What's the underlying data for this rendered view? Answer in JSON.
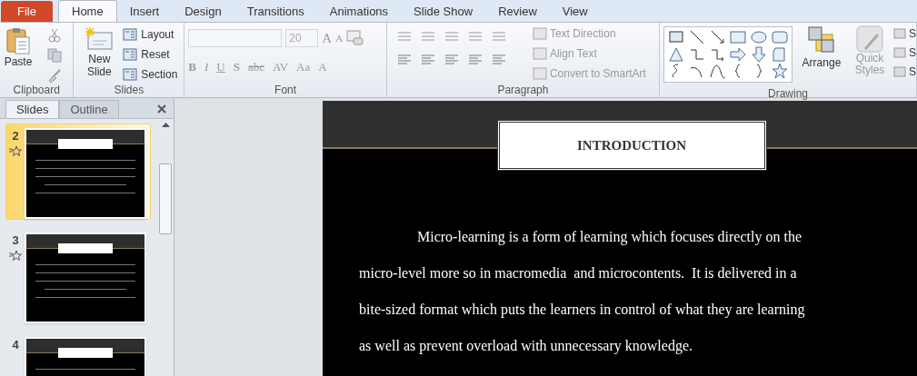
{
  "tabs": [
    {
      "label": "File",
      "kind": "file",
      "selected": false
    },
    {
      "label": "Home",
      "kind": "tab",
      "selected": true
    },
    {
      "label": "Insert",
      "kind": "tab",
      "selected": false
    },
    {
      "label": "Design",
      "kind": "tab",
      "selected": false
    },
    {
      "label": "Transitions",
      "kind": "tab",
      "selected": false
    },
    {
      "label": "Animations",
      "kind": "tab",
      "selected": false
    },
    {
      "label": "Slide Show",
      "kind": "tab",
      "selected": false
    },
    {
      "label": "Review",
      "kind": "tab",
      "selected": false
    },
    {
      "label": "View",
      "kind": "tab",
      "selected": false
    }
  ],
  "ribbon": {
    "clipboard": {
      "label": "Clipboard",
      "paste": "Paste"
    },
    "slides": {
      "label": "Slides",
      "new_slide": [
        "New",
        "Slide"
      ],
      "commands": [
        "Layout",
        "Reset",
        "Section"
      ]
    },
    "font": {
      "label": "Font",
      "font_size": "20",
      "size_buttons": [
        "A",
        "A"
      ],
      "disabled": true,
      "format_buttons": [
        "B",
        "I",
        "U",
        "S",
        "abc",
        "AV",
        "Aa",
        "A"
      ]
    },
    "paragraph": {
      "label": "Paragraph",
      "commands": [
        {
          "label": "Text Direction",
          "disabled": true
        },
        {
          "label": "Align Text",
          "disabled": true
        },
        {
          "label": "Convert to SmartArt",
          "disabled": true
        }
      ]
    },
    "drawing": {
      "label": "Drawing",
      "arrange": "Arrange",
      "quick_styles": [
        "Quick",
        "Styles"
      ],
      "quick_styles_disabled": true,
      "shape_commands": [
        "S",
        "S",
        "S"
      ]
    }
  },
  "slides_pane": {
    "tabs": [
      {
        "label": "Slides",
        "selected": true
      },
      {
        "label": "Outline",
        "selected": false
      }
    ],
    "thumbnails": [
      {
        "number": "2",
        "selected": true,
        "animated": true
      },
      {
        "number": "3",
        "selected": false,
        "animated": true
      },
      {
        "number": "4",
        "selected": false,
        "animated": false
      }
    ]
  },
  "slide": {
    "title": "INTRODUCTION",
    "body_lines": [
      "Micro-learning is a form of learning which focuses directly on the",
      "micro-level more so in macromedia  and microcontents.  It is delivered in a",
      "bite-sized format which puts the learners in control of what they are learning",
      "as well as prevent overload with unnecessary knowledge."
    ]
  }
}
